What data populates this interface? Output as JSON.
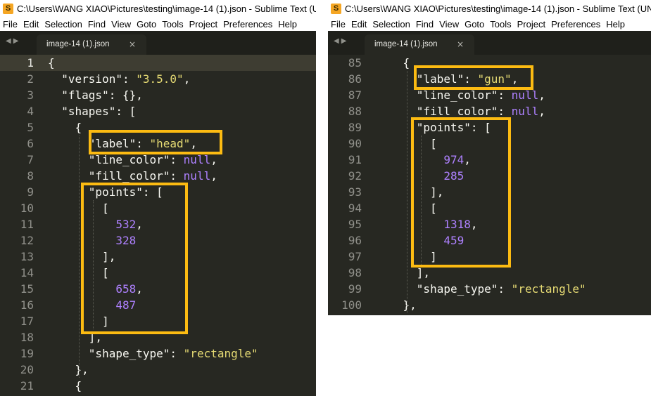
{
  "app": {
    "icon_glyph": "S"
  },
  "left": {
    "title": "C:\\Users\\WANG XIAO\\Pictures\\testing\\image-14 (1).json - Sublime Text (U",
    "menu": [
      "File",
      "Edit",
      "Selection",
      "Find",
      "View",
      "Goto",
      "Tools",
      "Project",
      "Preferences",
      "Help"
    ],
    "tab_label": "image-14 (1).json",
    "tab_close": "×",
    "line_numbers": [
      "1",
      "2",
      "3",
      "4",
      "5",
      "6",
      "7",
      "8",
      "9",
      "10",
      "11",
      "12",
      "13",
      "14",
      "15",
      "16",
      "17",
      "18",
      "19",
      "20",
      "21"
    ],
    "lines": [
      "{",
      "  \"version\": \"3.5.0\",",
      "  \"flags\": {},",
      "  \"shapes\": [",
      "    {",
      "      \"label\": \"head\",",
      "      \"line_color\": null,",
      "      \"fill_color\": null,",
      "      \"points\": [",
      "        [",
      "          532,",
      "          328",
      "        ],",
      "        [",
      "          658,",
      "          487",
      "        ]",
      "      ],",
      "      \"shape_type\": \"rectangle\"",
      "    },",
      "    {"
    ]
  },
  "right": {
    "title": "C:\\Users\\WANG XIAO\\Pictures\\testing\\image-14 (1).json - Sublime Text (UN",
    "menu": [
      "File",
      "Edit",
      "Selection",
      "Find",
      "View",
      "Goto",
      "Tools",
      "Project",
      "Preferences",
      "Help"
    ],
    "tab_label": "image-14 (1).json",
    "tab_close": "×",
    "line_numbers": [
      "85",
      "86",
      "87",
      "88",
      "89",
      "90",
      "91",
      "92",
      "93",
      "94",
      "95",
      "96",
      "97",
      "98",
      "99",
      "100"
    ],
    "lines": [
      "    {",
      "      \"label\": \"gun\",",
      "      \"line_color\": null,",
      "      \"fill_color\": null,",
      "      \"points\": [",
      "        [",
      "          974,",
      "          285",
      "        ],",
      "        [",
      "          1318,",
      "          459",
      "        ]",
      "      ],",
      "      \"shape_type\": \"rectangle\"",
      "    },"
    ]
  },
  "colors": {
    "editor_bg": "#272822",
    "highlight_box": "#fcbb12",
    "string": "#e6db74",
    "number": "#ae81ff"
  }
}
